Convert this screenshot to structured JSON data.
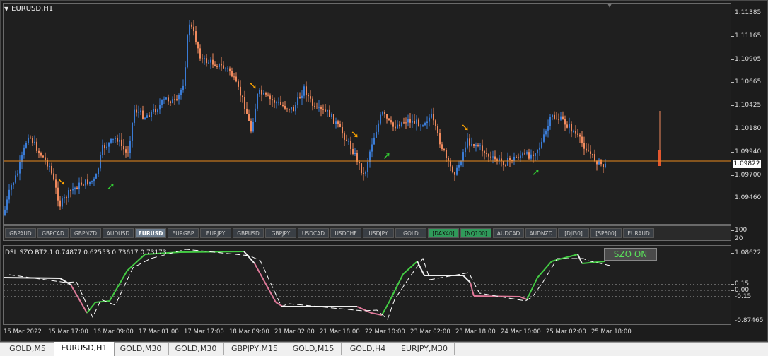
{
  "chart": {
    "title": "EURUSD,H1",
    "current_price": "1.09822",
    "price_scale": [
      "1.11385",
      "1.11165",
      "1.10905",
      "1.10665",
      "1.10425",
      "1.10180",
      "1.09940",
      "1.09700",
      "1.09460"
    ],
    "time_axis": [
      "15 Mar 2022",
      "15 Mar 17:00",
      "16 Mar 09:00",
      "17 Mar 01:00",
      "17 Mar 17:00",
      "18 Mar 09:00",
      "21 Mar 02:00",
      "21 Mar 18:00",
      "22 Mar 10:00",
      "23 Mar 02:00",
      "23 Mar 18:00",
      "24 Mar 10:00",
      "25 Mar 02:00",
      "25 Mar 18:00"
    ]
  },
  "symbols": [
    "GBPAUD",
    "GBPCAD",
    "GBPNZD",
    "AUDUSD",
    "EURUSD",
    "EURGBP",
    "EURJPY",
    "GBPUSD",
    "GBPJPY",
    "USDCAD",
    "USDCHF",
    "USDJPY",
    "GOLD",
    "[DAX40]",
    "[NQ100]",
    "AUDCAD",
    "AUDNZD",
    "[DJI30]",
    "[SP500]",
    "EURAUD"
  ],
  "active_symbol": "EURUSD",
  "green_symbols": [
    "[DAX40]",
    "[NQ100]"
  ],
  "symbar_scale": [
    "100",
    "20"
  ],
  "indicator": {
    "label": "DSL SZO BT2.1 0.74877 0.62553 0.73617 0.73173",
    "button": "SZO ON",
    "scale": [
      "1.08622",
      "0.15",
      "0.00",
      "-0.15",
      "-0.87465"
    ]
  },
  "tabs": [
    "GOLD,M5",
    "EURUSD,H1",
    "GOLD,M30",
    "GOLD,M30",
    "GBPJPY,M15",
    "GOLD,M15",
    "GOLD,H4",
    "EURJPY,M30"
  ],
  "active_tab": 1,
  "colors": {
    "bull": "#3a7bd5",
    "bear": "#f08a5d",
    "up_arrow": "#33cc33",
    "down_arrow": "#ffa500",
    "price_line": "#e8891e"
  }
}
